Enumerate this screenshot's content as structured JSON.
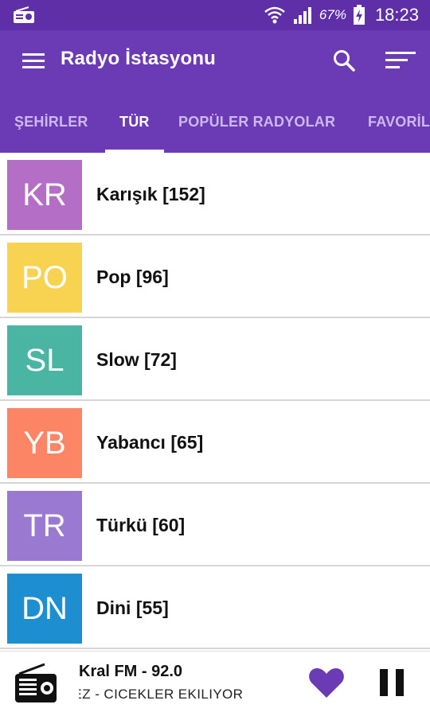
{
  "status_bar": {
    "battery_percent": "67%",
    "time": "18:23",
    "icons": [
      "radio-icon",
      "wifi-icon",
      "signal-icon",
      "battery-charging-icon"
    ]
  },
  "app_bar": {
    "title": "Radyo İstasyonu",
    "icons": [
      "menu-icon",
      "search-icon",
      "sort-icon"
    ]
  },
  "tabs": [
    {
      "label": "ŞEHİRLER",
      "active": false
    },
    {
      "label": "TÜR",
      "active": true
    },
    {
      "label": "POPÜLER RADYOLAR",
      "active": false
    },
    {
      "label": "FAVORİLER",
      "active": false
    }
  ],
  "genres": [
    {
      "abbr": "KR",
      "label": "Karışık [152]",
      "color": "#b56ec6"
    },
    {
      "abbr": "PO",
      "label": "Pop [96]",
      "color": "#f8d351"
    },
    {
      "abbr": "SL",
      "label": "Slow [72]",
      "color": "#4ab5a3"
    },
    {
      "abbr": "YB",
      "label": "Yabancı [65]",
      "color": "#fb8564"
    },
    {
      "abbr": "TR",
      "label": "Türkü [60]",
      "color": "#9a7ad1"
    },
    {
      "abbr": "DN",
      "label": "Dini [55]",
      "color": "#1d8fd0"
    }
  ],
  "player": {
    "station": "Kral FM - 92.0",
    "song": "MEZ - CICEKLER EKILIYOR",
    "accent_color": "#6a3bb5"
  },
  "colors": {
    "status_bar": "#5e2fa6",
    "app_bar": "#6a3bb5",
    "tab_inactive": "#cdb8ee"
  }
}
